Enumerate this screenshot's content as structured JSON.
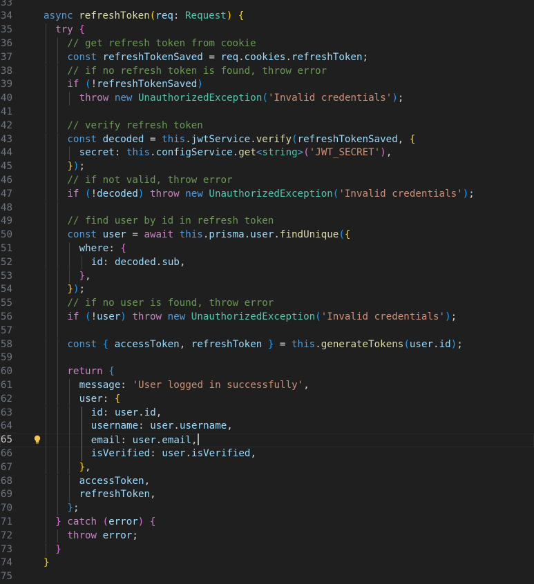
{
  "editor": {
    "current_line": 65,
    "lines": [
      {
        "n": "33",
        "indent": 0,
        "tokens": []
      },
      {
        "n": "34",
        "indent": 0,
        "tokens": [
          [
            "kw",
            "async "
          ],
          [
            "fn",
            "refreshToken"
          ],
          [
            "br1",
            "("
          ],
          [
            "var",
            "req"
          ],
          [
            "plain",
            ": "
          ],
          [
            "type",
            "Request"
          ],
          [
            "br1",
            ")"
          ],
          [
            "plain",
            " "
          ],
          [
            "br1",
            "{"
          ]
        ]
      },
      {
        "n": "35",
        "indent": 1,
        "tokens": [
          [
            "ctrl",
            "try "
          ],
          [
            "br2",
            "{"
          ]
        ]
      },
      {
        "n": "36",
        "indent": 2,
        "tokens": [
          [
            "cm",
            "// get refresh token from cookie"
          ]
        ]
      },
      {
        "n": "37",
        "indent": 2,
        "tokens": [
          [
            "kw",
            "const "
          ],
          [
            "var",
            "refreshTokenSaved"
          ],
          [
            "plain",
            " = "
          ],
          [
            "var",
            "req"
          ],
          [
            "plain",
            "."
          ],
          [
            "var",
            "cookies"
          ],
          [
            "plain",
            "."
          ],
          [
            "var",
            "refreshToken"
          ],
          [
            "plain",
            ";"
          ]
        ]
      },
      {
        "n": "38",
        "indent": 2,
        "tokens": [
          [
            "cm",
            "// if no refresh token is found, throw error"
          ]
        ]
      },
      {
        "n": "39",
        "indent": 2,
        "tokens": [
          [
            "ctrl",
            "if "
          ],
          [
            "br3",
            "("
          ],
          [
            "plain",
            "!"
          ],
          [
            "var",
            "refreshTokenSaved"
          ],
          [
            "br3",
            ")"
          ]
        ]
      },
      {
        "n": "40",
        "indent": 3,
        "tokens": [
          [
            "ctrl",
            "throw "
          ],
          [
            "kw",
            "new "
          ],
          [
            "cls",
            "UnauthorizedException"
          ],
          [
            "br3",
            "("
          ],
          [
            "str",
            "'Invalid credentials'"
          ],
          [
            "br3",
            ")"
          ],
          [
            "plain",
            ";"
          ]
        ]
      },
      {
        "n": "41",
        "indent": 2,
        "tokens": []
      },
      {
        "n": "42",
        "indent": 2,
        "tokens": [
          [
            "cm",
            "// verify refresh token"
          ]
        ]
      },
      {
        "n": "43",
        "indent": 2,
        "tokens": [
          [
            "kw",
            "const "
          ],
          [
            "var",
            "decoded"
          ],
          [
            "plain",
            " = "
          ],
          [
            "kw",
            "this"
          ],
          [
            "plain",
            "."
          ],
          [
            "var",
            "jwtService"
          ],
          [
            "plain",
            "."
          ],
          [
            "fn",
            "verify"
          ],
          [
            "br3",
            "("
          ],
          [
            "var",
            "refreshTokenSaved"
          ],
          [
            "plain",
            ", "
          ],
          [
            "br1",
            "{"
          ]
        ]
      },
      {
        "n": "44",
        "indent": 3,
        "tokens": [
          [
            "prop",
            "secret"
          ],
          [
            "plain",
            ": "
          ],
          [
            "kw",
            "this"
          ],
          [
            "plain",
            "."
          ],
          [
            "var",
            "configService"
          ],
          [
            "plain",
            "."
          ],
          [
            "fn",
            "get"
          ],
          [
            "kw",
            "<"
          ],
          [
            "type",
            "string"
          ],
          [
            "kw",
            ">"
          ],
          [
            "br2",
            "("
          ],
          [
            "str",
            "'JWT_SECRET'"
          ],
          [
            "br2",
            ")"
          ],
          [
            "plain",
            ","
          ]
        ]
      },
      {
        "n": "45",
        "indent": 2,
        "tokens": [
          [
            "br1",
            "}"
          ],
          [
            "br3",
            ")"
          ],
          [
            "plain",
            ";"
          ]
        ]
      },
      {
        "n": "46",
        "indent": 2,
        "tokens": [
          [
            "cm",
            "// if not valid, throw error"
          ]
        ]
      },
      {
        "n": "47",
        "indent": 2,
        "tokens": [
          [
            "ctrl",
            "if "
          ],
          [
            "br3",
            "("
          ],
          [
            "plain",
            "!"
          ],
          [
            "var",
            "decoded"
          ],
          [
            "br3",
            ")"
          ],
          [
            "plain",
            " "
          ],
          [
            "ctrl",
            "throw "
          ],
          [
            "kw",
            "new "
          ],
          [
            "cls",
            "UnauthorizedException"
          ],
          [
            "br3",
            "("
          ],
          [
            "str",
            "'Invalid credentials'"
          ],
          [
            "br3",
            ")"
          ],
          [
            "plain",
            ";"
          ]
        ]
      },
      {
        "n": "48",
        "indent": 2,
        "tokens": []
      },
      {
        "n": "49",
        "indent": 2,
        "tokens": [
          [
            "cm",
            "// find user by id in refresh token"
          ]
        ]
      },
      {
        "n": "50",
        "indent": 2,
        "tokens": [
          [
            "kw",
            "const "
          ],
          [
            "var",
            "user"
          ],
          [
            "plain",
            " = "
          ],
          [
            "ctrl",
            "await "
          ],
          [
            "kw",
            "this"
          ],
          [
            "plain",
            "."
          ],
          [
            "var",
            "prisma"
          ],
          [
            "plain",
            "."
          ],
          [
            "var",
            "user"
          ],
          [
            "plain",
            "."
          ],
          [
            "fn",
            "findUnique"
          ],
          [
            "br3",
            "("
          ],
          [
            "br1",
            "{"
          ]
        ]
      },
      {
        "n": "51",
        "indent": 3,
        "tokens": [
          [
            "prop",
            "where"
          ],
          [
            "plain",
            ": "
          ],
          [
            "br2",
            "{"
          ]
        ]
      },
      {
        "n": "52",
        "indent": 4,
        "tokens": [
          [
            "prop",
            "id"
          ],
          [
            "plain",
            ": "
          ],
          [
            "var",
            "decoded"
          ],
          [
            "plain",
            "."
          ],
          [
            "var",
            "sub"
          ],
          [
            "plain",
            ","
          ]
        ]
      },
      {
        "n": "53",
        "indent": 3,
        "tokens": [
          [
            "br2",
            "}"
          ],
          [
            "plain",
            ","
          ]
        ]
      },
      {
        "n": "54",
        "indent": 2,
        "tokens": [
          [
            "br1",
            "}"
          ],
          [
            "br3",
            ")"
          ],
          [
            "plain",
            ";"
          ]
        ]
      },
      {
        "n": "55",
        "indent": 2,
        "tokens": [
          [
            "cm",
            "// if no user is found, throw error"
          ]
        ]
      },
      {
        "n": "56",
        "indent": 2,
        "tokens": [
          [
            "ctrl",
            "if "
          ],
          [
            "br3",
            "("
          ],
          [
            "plain",
            "!"
          ],
          [
            "var",
            "user"
          ],
          [
            "br3",
            ")"
          ],
          [
            "plain",
            " "
          ],
          [
            "ctrl",
            "throw "
          ],
          [
            "kw",
            "new "
          ],
          [
            "cls",
            "UnauthorizedException"
          ],
          [
            "br3",
            "("
          ],
          [
            "str",
            "'Invalid credentials'"
          ],
          [
            "br3",
            ")"
          ],
          [
            "plain",
            ";"
          ]
        ]
      },
      {
        "n": "57",
        "indent": 2,
        "tokens": []
      },
      {
        "n": "58",
        "indent": 2,
        "tokens": [
          [
            "kw",
            "const "
          ],
          [
            "br3",
            "{"
          ],
          [
            "plain",
            " "
          ],
          [
            "var",
            "accessToken"
          ],
          [
            "plain",
            ", "
          ],
          [
            "var",
            "refreshToken"
          ],
          [
            "plain",
            " "
          ],
          [
            "br3",
            "}"
          ],
          [
            "plain",
            " = "
          ],
          [
            "kw",
            "this"
          ],
          [
            "plain",
            "."
          ],
          [
            "fn",
            "generateTokens"
          ],
          [
            "br3",
            "("
          ],
          [
            "var",
            "user"
          ],
          [
            "plain",
            "."
          ],
          [
            "var",
            "id"
          ],
          [
            "br3",
            ")"
          ],
          [
            "plain",
            ";"
          ]
        ]
      },
      {
        "n": "59",
        "indent": 2,
        "tokens": []
      },
      {
        "n": "60",
        "indent": 2,
        "tokens": [
          [
            "ctrl",
            "return "
          ],
          [
            "br3",
            "{"
          ]
        ]
      },
      {
        "n": "61",
        "indent": 3,
        "tokens": [
          [
            "prop",
            "message"
          ],
          [
            "plain",
            ": "
          ],
          [
            "str",
            "'User logged in successfully'"
          ],
          [
            "plain",
            ","
          ]
        ]
      },
      {
        "n": "62",
        "indent": 3,
        "tokens": [
          [
            "prop",
            "user"
          ],
          [
            "plain",
            ": "
          ],
          [
            "br1",
            "{"
          ]
        ]
      },
      {
        "n": "63",
        "indent": 4,
        "tokens": [
          [
            "prop",
            "id"
          ],
          [
            "plain",
            ": "
          ],
          [
            "var",
            "user"
          ],
          [
            "plain",
            "."
          ],
          [
            "var",
            "id"
          ],
          [
            "plain",
            ","
          ]
        ]
      },
      {
        "n": "64",
        "indent": 4,
        "tokens": [
          [
            "prop",
            "username"
          ],
          [
            "plain",
            ": "
          ],
          [
            "var",
            "user"
          ],
          [
            "plain",
            "."
          ],
          [
            "var",
            "username"
          ],
          [
            "plain",
            ","
          ]
        ]
      },
      {
        "n": "65",
        "indent": 4,
        "tokens": [
          [
            "prop",
            "email"
          ],
          [
            "plain",
            ": "
          ],
          [
            "var",
            "user"
          ],
          [
            "plain",
            "."
          ],
          [
            "var",
            "email"
          ],
          [
            "plain",
            ","
          ]
        ]
      },
      {
        "n": "66",
        "indent": 4,
        "tokens": [
          [
            "prop",
            "isVerified"
          ],
          [
            "plain",
            ": "
          ],
          [
            "var",
            "user"
          ],
          [
            "plain",
            "."
          ],
          [
            "var",
            "isVerified"
          ],
          [
            "plain",
            ","
          ]
        ]
      },
      {
        "n": "67",
        "indent": 3,
        "tokens": [
          [
            "br1",
            "}"
          ],
          [
            "plain",
            ","
          ]
        ]
      },
      {
        "n": "68",
        "indent": 3,
        "tokens": [
          [
            "prop",
            "accessToken"
          ],
          [
            "plain",
            ","
          ]
        ]
      },
      {
        "n": "69",
        "indent": 3,
        "tokens": [
          [
            "prop",
            "refreshToken"
          ],
          [
            "plain",
            ","
          ]
        ]
      },
      {
        "n": "70",
        "indent": 2,
        "tokens": [
          [
            "br3",
            "}"
          ],
          [
            "plain",
            ";"
          ]
        ]
      },
      {
        "n": "71",
        "indent": 1,
        "tokens": [
          [
            "br2",
            "}"
          ],
          [
            "plain",
            " "
          ],
          [
            "ctrl",
            "catch "
          ],
          [
            "br2",
            "("
          ],
          [
            "var",
            "error"
          ],
          [
            "br2",
            ")"
          ],
          [
            "plain",
            " "
          ],
          [
            "br2",
            "{"
          ]
        ]
      },
      {
        "n": "72",
        "indent": 2,
        "tokens": [
          [
            "ctrl",
            "throw "
          ],
          [
            "var",
            "error"
          ],
          [
            "plain",
            ";"
          ]
        ]
      },
      {
        "n": "73",
        "indent": 1,
        "tokens": [
          [
            "br2",
            "}"
          ]
        ]
      },
      {
        "n": "74",
        "indent": 0,
        "tokens": [
          [
            "br1",
            "}"
          ]
        ]
      },
      {
        "n": "75",
        "indent": 0,
        "tokens": []
      }
    ]
  }
}
